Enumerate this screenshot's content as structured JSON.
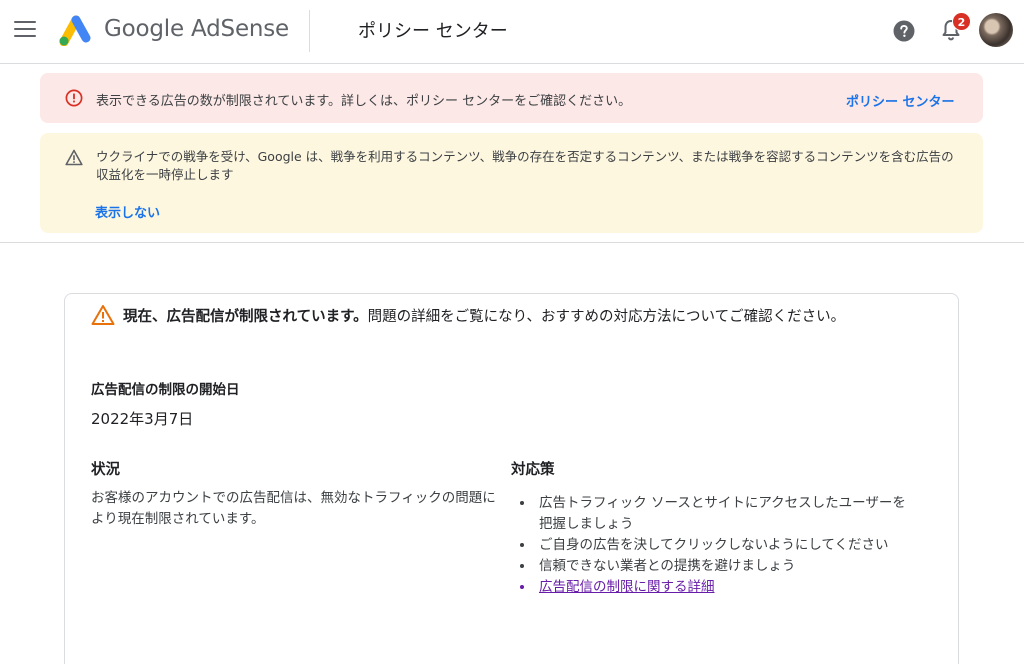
{
  "header": {
    "brand": "Google AdSense",
    "page_title": "ポリシー センター",
    "notification_count": "2",
    "icons": [
      "menu-icon",
      "adsense-logo",
      "help-icon",
      "bell-icon",
      "avatar"
    ]
  },
  "alerts": {
    "error": {
      "text": "表示できる広告の数が制限されています。詳しくは、ポリシー センターをご確認ください。",
      "link": "ポリシー センター",
      "color": "#fce8e6"
    },
    "warning": {
      "text": "ウクライナでの戦争を受け、Google は、戦争を利用するコンテンツ、戦争の存在を否定するコンテンツ、または戦争を容認するコンテンツを含む広告の収益化を一時停止します",
      "link": "表示しない",
      "color": "#fef7e0"
    }
  },
  "card": {
    "headline_bold": "現在、広告配信が制限されています。",
    "headline_rest": "問題の詳細をご覧になり、おすすめの対応方法についてご確認ください。",
    "start_label": "広告配信の制限の開始日",
    "start_value": "2022年3月7日",
    "status_heading": "状況",
    "status_text": "お客様のアカウントでの広告配信は、無効なトラフィックの問題により現在制限されています。",
    "action_heading": "対応策",
    "actions": [
      "広告トラフィック ソースとサイトにアクセスしたユーザーを把握しましょう",
      "ご自身の広告を決してクリックしないようにしてください",
      "信頼できない業者との提携を避けましょう",
      "広告配信の制限に関する詳細"
    ]
  },
  "colors": {
    "link": "#1a73e8",
    "visited_link": "#681da8",
    "error_icon": "#d93025",
    "warning_icon": "#e8710a",
    "badge": "#d93025"
  }
}
